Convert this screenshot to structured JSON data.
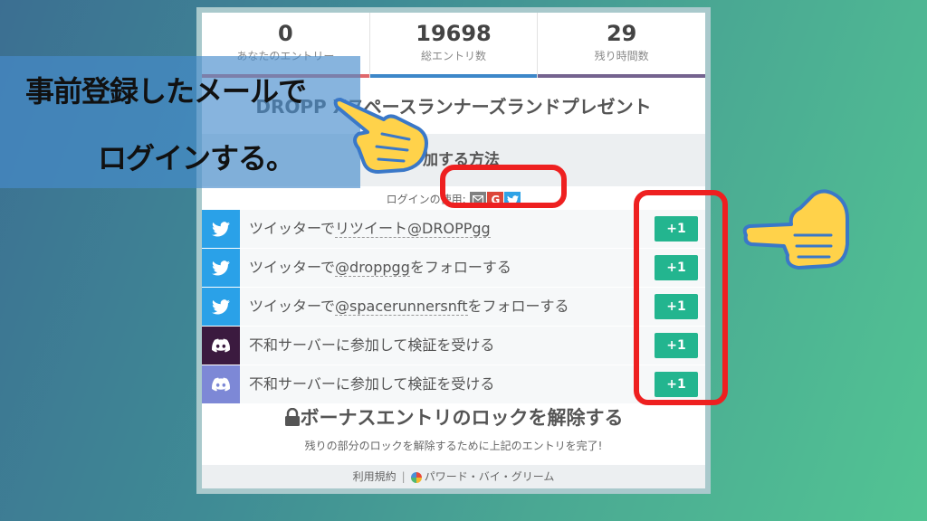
{
  "stats": [
    {
      "value": "0",
      "label": "あなたのエントリー"
    },
    {
      "value": "19698",
      "label": "総エントリ数"
    },
    {
      "value": "29",
      "label": "残り時間数"
    }
  ],
  "giveaway_title": "DROPP Xスペースランナーズランドプレゼント",
  "how_to_enter": "参加する方法",
  "login_label": "ログインの使用:",
  "login_icons": [
    "mail-icon",
    "google-icon",
    "twitter-icon"
  ],
  "entries": [
    {
      "icon": "twitter-icon",
      "prefix": "ツイッターで",
      "link": "リツイート@DROPPgg",
      "suffix": "",
      "points": "+1"
    },
    {
      "icon": "twitter-icon",
      "prefix": "ツイッターで",
      "link": "@droppgg",
      "suffix": "をフォローする",
      "points": "+1"
    },
    {
      "icon": "twitter-icon",
      "prefix": "ツイッターで",
      "link": "@spacerunnersnft",
      "suffix": "をフォローする",
      "points": "+1"
    },
    {
      "icon": "discord-icon",
      "prefix": "不和サーバーに参加して検証を受ける",
      "link": "",
      "suffix": "",
      "points": "+1"
    },
    {
      "icon": "discord-icon",
      "prefix": "不和サーバーに参加して検証を受ける",
      "link": "",
      "suffix": "",
      "points": "+1"
    }
  ],
  "bonus_title": "ボーナスエントリのロックを解除する",
  "bonus_subtitle": "残りの部分のロックを解除するために上記のエントリを完了!",
  "footer": {
    "terms": "利用規約",
    "powered_by": "パワード・バイ・グリーム"
  },
  "annotation": {
    "line1": "事前登録したメールで",
    "line2": "ログインする。"
  },
  "colors": {
    "plus_button": "#23b58f",
    "highlight": "#ee2020",
    "twitter": "#2aa1e8"
  }
}
